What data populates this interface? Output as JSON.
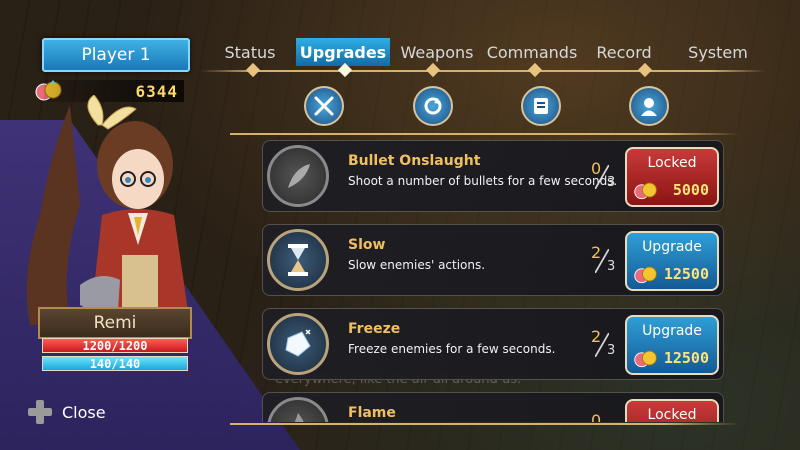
{
  "player": {
    "label": "Player 1",
    "gold": "6344"
  },
  "character": {
    "name": "Remi",
    "hp": {
      "text": "1200/1200",
      "fraction": 1.0
    },
    "mp": {
      "text": "140/140",
      "fraction": 1.0
    }
  },
  "close_label": "Close",
  "tabs": [
    {
      "label": "Status",
      "active": false
    },
    {
      "label": "Upgrades",
      "active": true
    },
    {
      "label": "Weapons",
      "active": false
    },
    {
      "label": "Commands",
      "active": false
    },
    {
      "label": "Record",
      "active": false
    },
    {
      "label": "System",
      "active": false
    }
  ],
  "sub_icons": [
    "crossed-swords-icon",
    "rotate-refresh-icon",
    "scroll-icon",
    "character-icon"
  ],
  "upgrades": [
    {
      "title": "Bullet Onslaught",
      "description": "Shoot a number of bullets for a few seconds.",
      "level": "0",
      "max": "3",
      "action": "Locked",
      "cost": "5000",
      "icon": "bullet-feather-icon"
    },
    {
      "title": "Slow",
      "description": "Slow enemies' actions.",
      "level": "2",
      "max": "3",
      "action": "Upgrade",
      "cost": "12500",
      "icon": "hourglass-icon"
    },
    {
      "title": "Freeze",
      "description": "Freeze enemies for a few seconds.",
      "level": "2",
      "max": "3",
      "action": "Upgrade",
      "cost": "12500",
      "icon": "ice-crystal-icon"
    },
    {
      "title": "Flame",
      "description": "",
      "level": "0",
      "max": "",
      "action": "Locked",
      "cost": "",
      "icon": "flame-icon"
    }
  ],
  "background_text": "everywhere, like the air all around us.",
  "colors": {
    "accent_blue": "#1a78b8",
    "gold": "#f0c060",
    "locked_red": "#c83a3a",
    "hp_red": "#c81b1b",
    "mp_cyan": "#1aa6d8"
  }
}
